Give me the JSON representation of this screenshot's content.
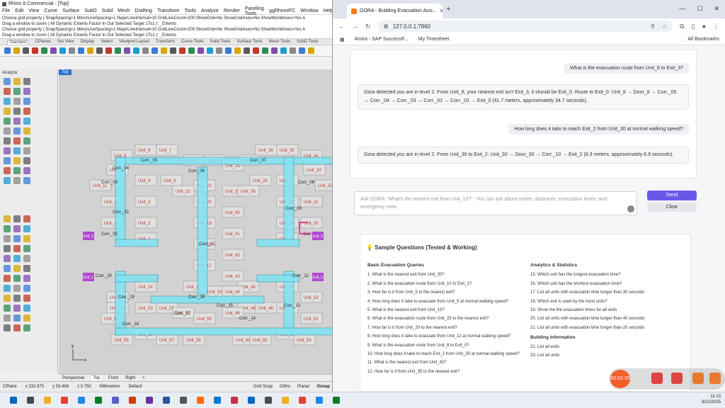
{
  "rhino": {
    "title": "Rhino 8 Commercial - [Top]",
    "menu": [
      "File",
      "Edit",
      "View",
      "Curve",
      "Surface",
      "SubD",
      "Solid",
      "Mesh",
      "Drafting",
      "Transform",
      "Tools",
      "Analyze",
      "Render",
      "Paneling Tools",
      "ggRhinoIFC",
      "Window",
      "Help"
    ],
    "cmd": [
      "Choose grid property ( SnapSpacing=1  MinorLineSpacing=1  MajorLineInterval=10  GridLineCount=200  ShowGrid=No  ShowGridAxes=No  ShowWorldAxes=Yes  A",
      "Drag a window to zoom ( All  Dynamic  Extents  Factor  In  Out  Selected  Target  1To1 ): _Extents",
      "Choose grid property ( SnapSpacing=1  MinorLineSpacing=1  MajorLineInterval=10  GridLineCount=200  ShowGrid=No  ShowGridAxes=No  ShowWorldAxes=Yes  A",
      "Drag a window to zoom ( All  Dynamic  Extents  Factor  In  Out  Selected  Target  1To1 ): _Extents",
      "Choose grid property ( SnapSpacing=1  MinorLineSpacing=1  MajorLineInterval=10  GridLineCount=200  ShowGrid=No  ShowGridAxes=No  ShowWorldAxes=Yes  A"
    ],
    "tabs": [
      "Standard",
      "CPlanes",
      "Set View",
      "Display",
      "Select",
      "Viewport Layout",
      "Transform",
      "Curve Tools",
      "Solid Tools",
      "Surface Tools",
      "Mesh Tools",
      "SubD Tools"
    ],
    "side_label": "Analyze",
    "viewport_label": "Top",
    "vp_tabs": [
      "Perspective",
      "Top",
      "Front",
      "Right",
      "+"
    ],
    "status": {
      "cplane": "CPlane",
      "x": "x 232.975",
      "y": "y 53.468",
      "z": "z 0.750",
      "units": "Millimeters",
      "layer": "Default",
      "toggles": [
        "Grid Snap",
        "Ortho",
        "Planar",
        "Osnap"
      ]
    },
    "axis_y": "y",
    "axis_x": "x"
  },
  "units": [
    [
      "Unit_9",
      66,
      116
    ],
    [
      "Unit_8",
      100,
      108
    ],
    [
      "Unit_7",
      130,
      108
    ],
    [
      "Unit_6",
      168,
      123
    ],
    [
      "Unit_23",
      198,
      123
    ],
    [
      "Unit_24",
      223,
      130
    ],
    [
      "Unit_25",
      245,
      123
    ],
    [
      "Unit_36",
      270,
      108
    ],
    [
      "Unit_35",
      300,
      108
    ],
    [
      "Unit_34",
      334,
      116
    ],
    [
      "Unit_10",
      60,
      136
    ],
    [
      "Unit_4",
      100,
      151
    ],
    [
      "Unit_5",
      136,
      151
    ],
    [
      "Unit_22",
      183,
      158
    ],
    [
      "Unit_26",
      262,
      151
    ],
    [
      "Unit_37",
      300,
      151
    ],
    [
      "Unit_33",
      338,
      136
    ],
    [
      "Unit_11",
      36,
      158
    ],
    [
      "Unit_21",
      153,
      166
    ],
    [
      "Unit_39",
      223,
      166
    ],
    [
      "Unit_38",
      245,
      166
    ],
    [
      "Unit_32",
      354,
      158
    ],
    [
      "Unit_12",
      52,
      181
    ],
    [
      "Unit_3",
      100,
      181
    ],
    [
      "Unit_20",
      183,
      181
    ],
    [
      "Unit_27",
      300,
      181
    ],
    [
      "Unit_31",
      334,
      181
    ],
    [
      "Unit_40",
      223,
      196
    ],
    [
      "Unit_13",
      52,
      211
    ],
    [
      "Unit_2",
      100,
      211
    ],
    [
      "Unit_19",
      183,
      211
    ],
    [
      "Unit_28",
      300,
      211
    ],
    [
      "Unit_30",
      334,
      211
    ],
    [
      "Unit_41",
      223,
      226
    ],
    [
      "Unit_1",
      100,
      233
    ],
    [
      "Unit_29",
      300,
      233
    ],
    [
      "Unit_18",
      183,
      241
    ],
    [
      "Unit_42",
      223,
      256
    ],
    [
      "Unit_17",
      183,
      271
    ],
    [
      "Unit_43",
      223,
      286
    ],
    [
      "Unit_14",
      100,
      301
    ],
    [
      "Unit_16",
      168,
      301
    ],
    [
      "Unit_45",
      245,
      301
    ],
    [
      "Unit_47",
      300,
      301
    ],
    [
      "Unit_50",
      198,
      308
    ],
    [
      "Unit_44",
      223,
      308
    ],
    [
      "Unit_62",
      334,
      316
    ],
    [
      "Unit_54",
      60,
      316
    ],
    [
      "Unit_53",
      100,
      331
    ],
    [
      "Unit_15",
      130,
      331
    ],
    [
      "Unit_51",
      153,
      338
    ],
    [
      "Unit_48",
      245,
      331
    ],
    [
      "Unit_46",
      270,
      331
    ],
    [
      "Unit_63",
      300,
      331
    ],
    [
      "Unit_52",
      60,
      331
    ],
    [
      "Unit_59",
      183,
      346
    ],
    [
      "Unit_49",
      223,
      338
    ],
    [
      "Unit_55",
      52,
      346
    ],
    [
      "Unit_61",
      334,
      346
    ],
    [
      "Unit_56",
      100,
      368
    ],
    [
      "Unit_64",
      300,
      368
    ],
    [
      "Unit_55",
      66,
      376
    ],
    [
      "Unit_57",
      130,
      376
    ],
    [
      "Unit_58",
      168,
      376
    ],
    [
      "Unit_66",
      238,
      376
    ],
    [
      "Unit_65",
      262,
      376
    ],
    [
      "Unit_63",
      324,
      376
    ]
  ],
  "corridors": [
    [
      "Corr._05",
      116,
      130
    ],
    [
      "Corr._06",
      183,
      145
    ],
    [
      "Corr._07",
      270,
      130
    ],
    [
      "Corr._04",
      76,
      141
    ],
    [
      "Corr._03",
      60,
      161
    ],
    [
      "Corr._08",
      338,
      161
    ],
    [
      "Corr._02",
      76,
      203
    ],
    [
      "Corr._09",
      320,
      198
    ],
    [
      "Corr._01",
      60,
      234
    ],
    [
      "Corr._11",
      198,
      248
    ],
    [
      "Corr._10",
      345,
      234
    ],
    [
      "Corr._20",
      52,
      293
    ],
    [
      "Corr._12",
      330,
      293
    ],
    [
      "Corr._16",
      183,
      323
    ],
    [
      "Corr._19",
      84,
      323
    ],
    [
      "Corr._17",
      163,
      346
    ],
    [
      "Corr._18",
      90,
      361
    ],
    [
      "Corr._13",
      318,
      335
    ],
    [
      "Corr._14",
      255,
      353
    ],
    [
      "Corr._15",
      223,
      335
    ]
  ],
  "exits": [
    "Exit_3",
    "Exit_1",
    "Exit_2"
  ],
  "browser": {
    "tab_title": "GORA - Building Evacuation Assi...",
    "url": "127.0.0.1:7860",
    "bookmarks": [
      "Amira - SAP SuccessF...",
      "My Timesheet"
    ],
    "all_bookmarks": "All Bookmarks"
  },
  "chat": [
    {
      "role": "user",
      "text": "What is the evacuation route from Unit_8 to Exit_3?"
    },
    {
      "role": "bot",
      "text": "Gora detected you are in level 2. From Unit_8, your nearest exit isn't Exit_3, it should be Exit_0. Route to Exit_0: Unit_8 → Door_8 → Corr._05 → Corr._04 → Corr._03 → Corr._02 → Corr._01 → Exit_0 (41.7 meters, approximately 34.7 seconds)."
    },
    {
      "role": "user",
      "text": "How long does it take to reach Exit_2 from Unit_30 at normal walking speed?"
    },
    {
      "role": "bot",
      "text": "Gora detected you are in level 2. From Unit_30 to Exit_2: Unit_30 → Door_30 → Corr._10 → Exit_2 (8.3 meters, approximately 6.9 seconds)."
    }
  ],
  "input": {
    "placeholder": "Ask GORA: 'What's the nearest exit from Unit_15?' - You can ask about routes, distances, evacuation times, and emergency exits"
  },
  "buttons": {
    "send": "Send",
    "clear": "Clear"
  },
  "samples": {
    "title": "Sample Questions (Tested & Working)",
    "basic_title": "Basic Evacuation Queries",
    "basic": [
      "1. What is the nearest exit from Unit_33?",
      "2. What is the evacuation route from Unit_10 to Exit_1?",
      "3. How far is it from Unit_5 to the nearest exit?",
      "4. How long does it take to evacuate from Unit_5 at normal walking speed?",
      "5. What is the nearest exit from Unit_15?",
      "6. What is the evacuation route from Unit_25 to the nearest exit?",
      "7. How far is it from Unit_20 to the nearest exit?",
      "8. How long does it take to evacuate from Unit_12 at normal walking speed?",
      "9. What is the evacuation route from Unit_8 to Exit_0?",
      "10. How long does it take to reach Exit_2 from Unit_30 at normal walking speed?",
      "11. What is the nearest exit from Unit_42?",
      "12. How far is it from Unit_35 to the nearest exit?"
    ],
    "analytics_title": "Analytics & Statistics",
    "analytics": [
      "15. Which unit has the longest evacuation time?",
      "16. Which unit has the shortest evacuation time?",
      "17. List all units with evacuation time longer than 30 seconds",
      "18. Which exit is used by the most units?",
      "19. Show me the evacuation times for all units",
      "20. List all units with evacuation time longer than 40 seconds",
      "21. List all units with evacuation time longer than 20 seconds"
    ],
    "building_title": "Building Information",
    "building": [
      "22. List all exits",
      "23. List all units"
    ]
  },
  "recorder": {
    "time": "00:01:29"
  },
  "tray": {
    "time": "11:13",
    "date": "6/21/2025"
  }
}
